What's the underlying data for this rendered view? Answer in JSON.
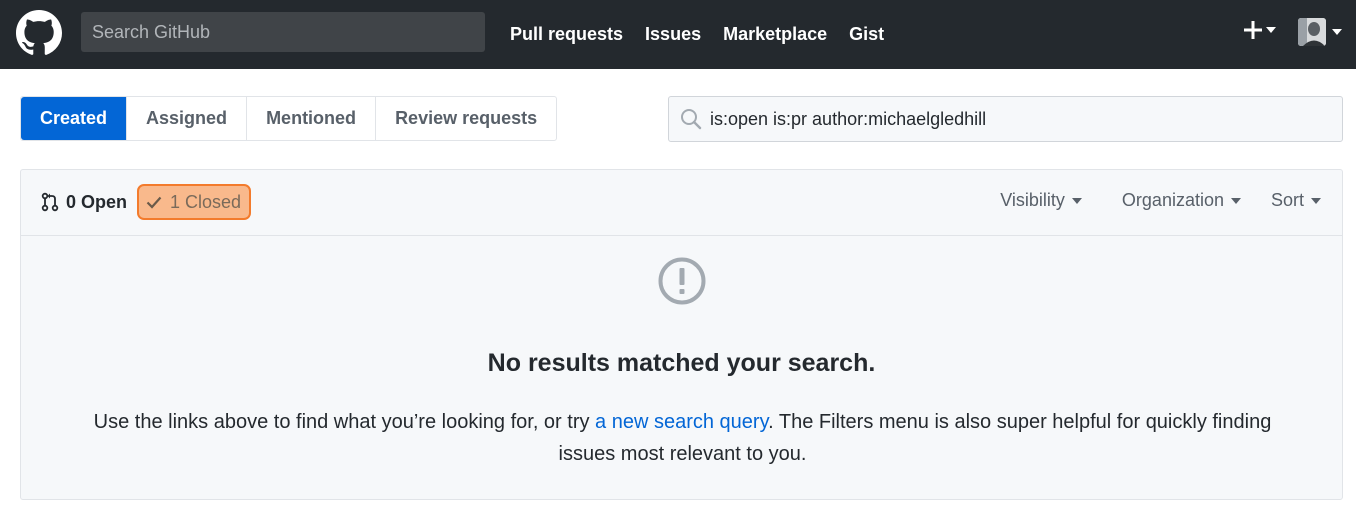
{
  "header": {
    "search_placeholder": "Search GitHub",
    "nav": [
      "Pull requests",
      "Issues",
      "Marketplace",
      "Gist"
    ]
  },
  "tabs": {
    "items": [
      "Created",
      "Assigned",
      "Mentioned",
      "Review requests"
    ],
    "selected": "Created"
  },
  "search": {
    "query": "is:open is:pr author:michaelgledhill"
  },
  "states": {
    "open_label": "0 Open",
    "closed_label": "1 Closed"
  },
  "filters": [
    "Visibility",
    "Organization",
    "Sort"
  ],
  "blankslate": {
    "title": "No results matched your search.",
    "text_before": "Use the links above to find what you’re looking for, or try ",
    "link_text": "a new search query",
    "text_after": ". The Filters menu is also super helpful for quickly finding issues most relevant to you."
  },
  "colors": {
    "header_bg": "#24292e",
    "accent": "#0366d6",
    "closed_highlight": "#f9b98c",
    "closed_highlight_border": "#f37b2c"
  }
}
